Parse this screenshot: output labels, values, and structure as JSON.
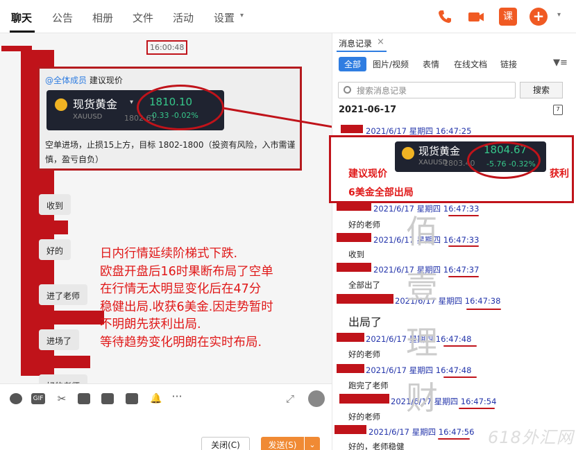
{
  "tabs": {
    "chat": "聊天",
    "notice": "公告",
    "album": "相册",
    "file": "文件",
    "activity": "活动",
    "settings": "设置"
  },
  "header_icons": {
    "lesson_label": "课",
    "more_label": "+",
    "colors": {
      "accent": "#f05a23"
    }
  },
  "chat": {
    "timestamp": "16:00:48",
    "mention_at": "@全体成员",
    "mention_text": "建议现价",
    "quote": {
      "name": "现货黄金",
      "code": "XAUUSD",
      "price": "1810.10",
      "change": "-0.33   -0.02%",
      "sub": "1802.61"
    },
    "message": "空单进场，止损15上方，目标 1802-1800（投资有风险，入市需谨慎，盈亏自负）",
    "replies": [
      "收到",
      "好的",
      "进了老师",
      "进场了",
      "好的老师"
    ],
    "annotation": "日内行情延续阶梯式下跌.\n欧盘开盘后16时果断布局了空单\n在行情无太明显变化后在47分\n稳健出局.收获6美金.因走势暂时\n不明朗先获利出局.\n等待趋势变化明朗在实时布局."
  },
  "toolbar": {
    "gif": "GIF",
    "close": "关闭(C)",
    "send": "发送(S)",
    "send_arrow": "⌄"
  },
  "history": {
    "title": "消息记录",
    "close": "×",
    "filters": [
      "全部",
      "图片/视频",
      "表情",
      "在线文档",
      "链接"
    ],
    "search_placeholder": "搜索消息记录",
    "search_button": "搜索",
    "date": "2021-06-17",
    "calendar": "7",
    "quote": {
      "name": "现货黄金",
      "code": "XAUUSD",
      "sub": "1803.40",
      "price": "1804.67",
      "change": "-5.76   -0.32%"
    },
    "annotation_left": "建议现价",
    "annotation_right": "获利",
    "annotation_bottom": "6美金全部出局",
    "records": [
      {
        "meta": "2021/6/17 星期四 16:47:25",
        "text": ""
      },
      {
        "meta": "2021/6/17 星期四 16:47:33",
        "text": "好的老师"
      },
      {
        "meta": "2021/6/17 星期四 16:47:33",
        "text": "收到"
      },
      {
        "meta": "2021/6/17 星期四 16:47:37",
        "text": "全部出了"
      },
      {
        "meta": "2021/6/17 星期四 16:47:38",
        "text": "出局了"
      },
      {
        "meta": "2021/6/17 星期四 16:47:48",
        "text": "好的老师"
      },
      {
        "meta": "2021/6/17 星期四 16:47:48",
        "text": "跑完了老师"
      },
      {
        "meta": "2021/6/17 星期四 16:47:54",
        "text": "好的老师"
      },
      {
        "meta": "2021/6/17 星期四 16:47:56",
        "text": "好的，老师稳健"
      }
    ],
    "watermark": [
      "佰",
      "壹",
      "理",
      "财"
    ],
    "brand": "618外汇网"
  }
}
